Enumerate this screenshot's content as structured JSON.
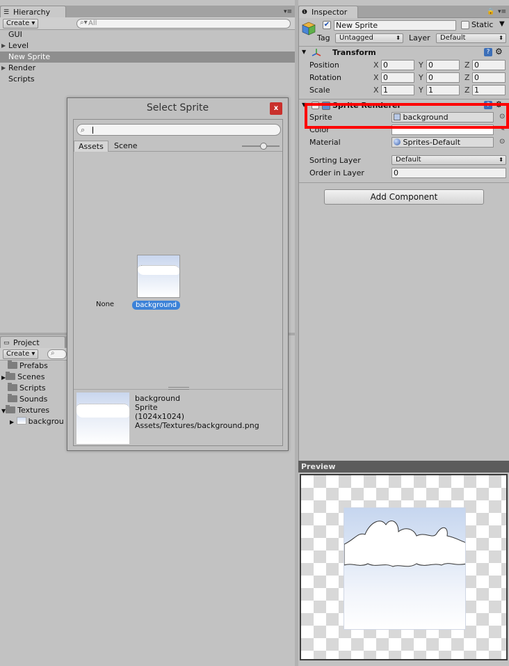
{
  "hierarchy": {
    "tab_label": "Hierarchy",
    "create_label": "Create",
    "search_placeholder": "All",
    "items": [
      {
        "label": "GUI"
      },
      {
        "label": "Level"
      },
      {
        "label": "New Sprite"
      },
      {
        "label": "Render"
      },
      {
        "label": "Scripts"
      }
    ]
  },
  "project": {
    "tab_label": "Project",
    "create_label": "Create",
    "items": [
      {
        "label": "Prefabs"
      },
      {
        "label": "Scenes"
      },
      {
        "label": "Scripts"
      },
      {
        "label": "Sounds"
      },
      {
        "label": "Textures"
      },
      {
        "label": "backgrou"
      }
    ]
  },
  "dialog": {
    "title": "Select Sprite",
    "close_label": "x",
    "tab_assets": "Assets",
    "tab_scene": "Scene",
    "slider_level": 0.6,
    "none_label": "None",
    "selected_label": "background",
    "info": {
      "name": "background",
      "type": "Sprite",
      "size": "(1024x1024)",
      "path": "Assets/Textures/background.png"
    }
  },
  "inspector": {
    "tab_label": "Inspector",
    "object_name": "New Sprite",
    "static_label": "Static",
    "tag_label": "Tag",
    "tag_value": "Untagged",
    "layer_label": "Layer",
    "layer_value": "Default",
    "transform": {
      "title": "Transform",
      "rows": [
        {
          "label": "Position",
          "x": "0",
          "y": "0",
          "z": "0"
        },
        {
          "label": "Rotation",
          "x": "0",
          "y": "0",
          "z": "0"
        },
        {
          "label": "Scale",
          "x": "1",
          "y": "1",
          "z": "1"
        }
      ],
      "axis_x": "X",
      "axis_y": "Y",
      "axis_z": "Z"
    },
    "sprite_renderer": {
      "title": "Sprite Renderer",
      "sprite_label": "Sprite",
      "sprite_value": "background",
      "color_label": "Color",
      "material_label": "Material",
      "material_value": "Sprites-Default",
      "sorting_layer_label": "Sorting Layer",
      "sorting_layer_value": "Default",
      "order_label": "Order in Layer",
      "order_value": "0"
    },
    "add_component": "Add Component"
  },
  "preview": {
    "label": "Preview"
  },
  "colors": {
    "highlight": "#ff0000",
    "selection": "#3c82d8",
    "close_button": "#c9302c"
  }
}
